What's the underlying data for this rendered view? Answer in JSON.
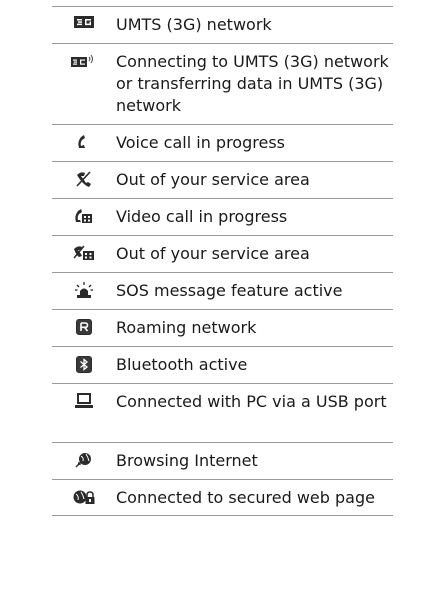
{
  "rows": [
    {
      "icon": "umts-3g-icon",
      "text": "UMTS (3G) network"
    },
    {
      "icon": "umts-3g-connecting-icon",
      "text": "Connecting to UMTS (3G) network or transferring data in UMTS (3G) network"
    },
    {
      "icon": "voice-call-icon",
      "text": "Voice call in progress"
    },
    {
      "icon": "voice-out-of-service-icon",
      "text": "Out of your service area"
    },
    {
      "icon": "video-call-icon",
      "text": "Video call in progress"
    },
    {
      "icon": "video-out-of-service-icon",
      "text": "Out of your service area"
    },
    {
      "icon": "sos-icon",
      "text": "SOS message feature active"
    },
    {
      "icon": "roaming-icon",
      "text": "Roaming network"
    },
    {
      "icon": "bluetooth-icon",
      "text": "Bluetooth active"
    },
    {
      "icon": "pc-usb-icon",
      "text": "Connected with PC via a USB port"
    },
    {
      "icon": "browsing-internet-icon",
      "text": "Browsing Internet"
    },
    {
      "icon": "secured-web-page-icon",
      "text": "Connected to secured web page"
    }
  ]
}
